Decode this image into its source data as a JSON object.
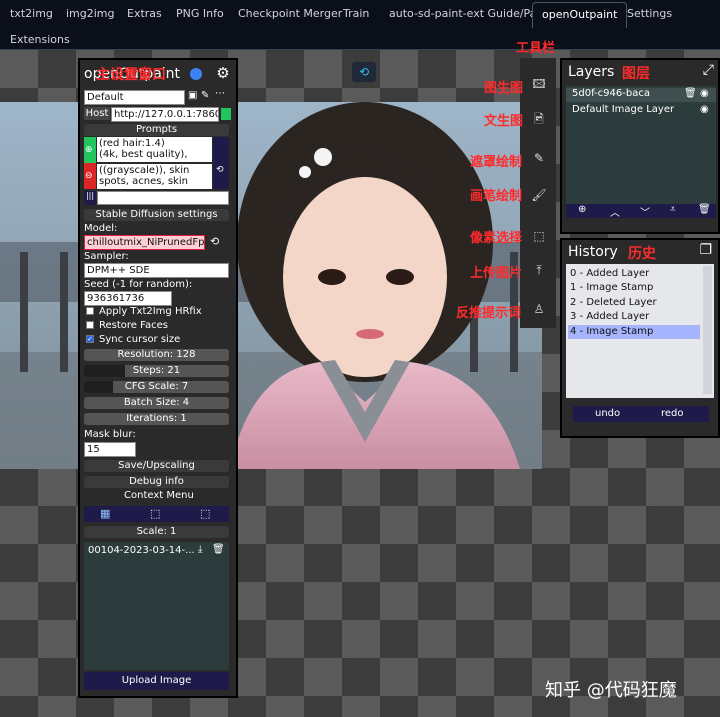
{
  "tabs": [
    "txt2img",
    "img2img",
    "Extras",
    "PNG Info",
    "Checkpoint Merger",
    "Train",
    "auto-sd-paint-ext Guide/Panel",
    "openOutpaint",
    "Settings",
    "Extensions"
  ],
  "active_tab": "openOutpaint",
  "main": {
    "title": "openOutpaint",
    "title_annotation": "主设置窗口",
    "preset": "Default",
    "host_label": "Host",
    "host_value": "http://127.0.0.1:7860",
    "prompts_header": "Prompts",
    "prompt_text": "(red hair:1.4)\n(4k, best quality),",
    "negative_text": "((grayscale)), skin\nspots, acnes, skin",
    "sd_header": "Stable Diffusion settings",
    "model_label": "Model:",
    "model_value": "chilloutmix_NiPrunedFp1",
    "sampler_label": "Sampler:",
    "sampler_value": "DPM++ SDE",
    "seed_label": "Seed (-1 for random):",
    "seed_value": "936361736",
    "checkboxes": [
      {
        "label": "Apply Txt2Img HRfix",
        "checked": false
      },
      {
        "label": "Restore Faces",
        "checked": false
      },
      {
        "label": "Sync cursor size",
        "checked": true
      }
    ],
    "sliders": [
      {
        "label": "Resolution: 128",
        "fill": 0.0
      },
      {
        "label": "Steps: 21",
        "fill": 0.28
      },
      {
        "label": "CFG Scale: 7",
        "fill": 0.2
      },
      {
        "label": "Batch Size: 4",
        "fill": 0.0
      },
      {
        "label": "Iterations: 1",
        "fill": 0.0
      }
    ],
    "mask_blur_label": "Mask blur:",
    "mask_blur_value": "15",
    "save_header": "Save/Upscaling",
    "debug_header": "Debug info",
    "context_menu_label": "Context Menu",
    "scale_label": "Scale: 1",
    "image_entry": "00104-2023-03-14-...",
    "upload_button": "Upload Image"
  },
  "toolbar": {
    "title": "工具栏",
    "tools": [
      {
        "icon": "img2img-icon",
        "annotation": "图生图"
      },
      {
        "icon": "txt2img-icon",
        "annotation": "文生图"
      },
      {
        "icon": "mask-brush-icon",
        "annotation": "遮罩绘制"
      },
      {
        "icon": "paint-brush-icon",
        "annotation": "画笔绘制"
      },
      {
        "icon": "selection-icon",
        "annotation": "像素选择"
      },
      {
        "icon": "upload-image-icon",
        "annotation": "上传图片"
      },
      {
        "icon": "interrogate-icon",
        "annotation": "反推提示词"
      }
    ]
  },
  "layers": {
    "title": "Layers",
    "annotation": "图层",
    "items": [
      "5d0f-c946-baca",
      "Default Image Layer"
    ]
  },
  "history": {
    "title": "History",
    "annotation": "历史",
    "items": [
      "0 - Added Layer",
      "1 - Image Stamp",
      "2 - Deleted Layer",
      "3 - Added Layer",
      "4 - Image Stamp"
    ],
    "selected_index": 4,
    "undo_label": "undo",
    "redo_label": "redo"
  },
  "watermark": "知乎 @代码狂魔"
}
